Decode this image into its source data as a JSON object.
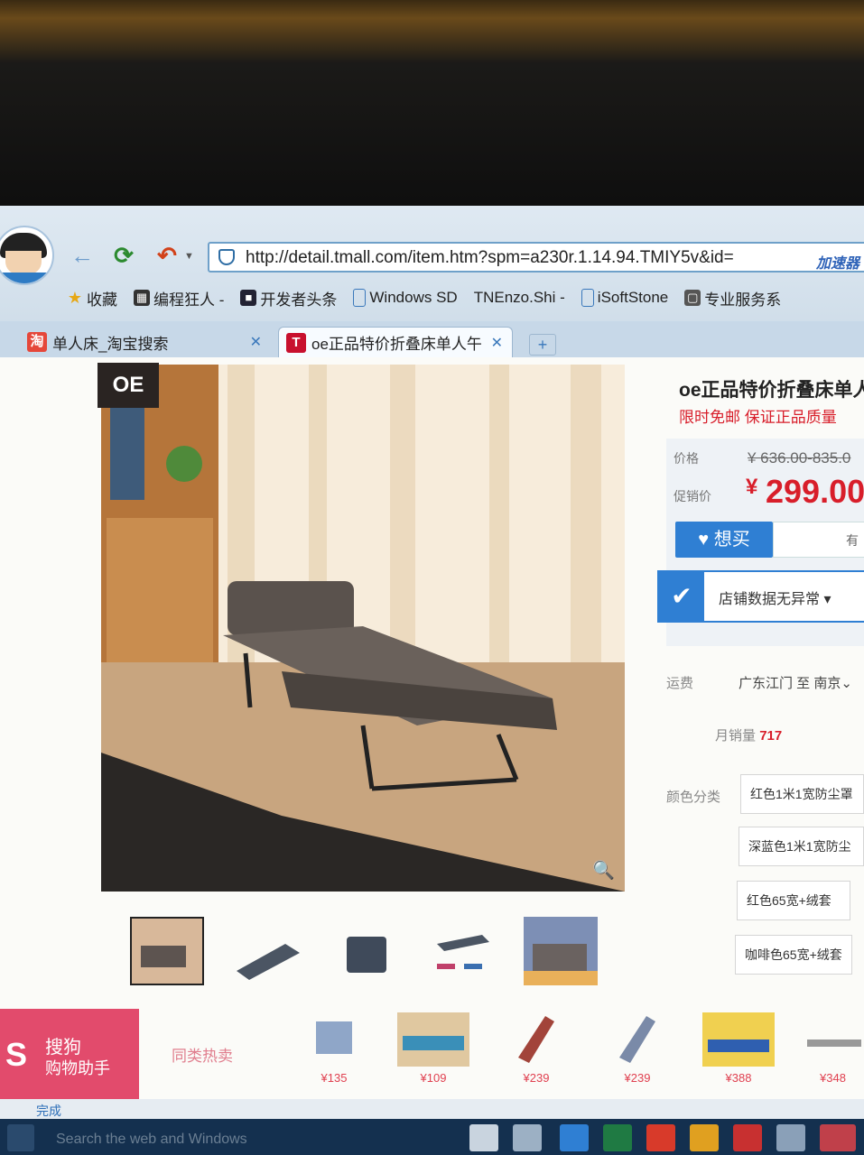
{
  "browser": {
    "url": "http://detail.tmall.com/item.htm?spm=a230r.1.14.94.TMIY5v&id=",
    "speed_label": "加速器",
    "bookmarks": [
      "收藏",
      "编程狂人 -",
      "开发者头条",
      "Windows SD",
      "TNEnzo.Shi -",
      "iSoftStone",
      "专业服务系"
    ],
    "tabs": [
      {
        "label": "单人床_淘宝搜索",
        "close": "✕"
      },
      {
        "label": "oe正品特价折叠床单人午",
        "close": "✕"
      }
    ],
    "new_tab": "+"
  },
  "product": {
    "logo": "OE",
    "title": "oe正品特价折叠床单人",
    "promo": "限时免邮 保证正品质量",
    "price_label": "价格",
    "old_price": "¥ 636.00-835.0",
    "promo_price_label": "促销价",
    "currency": "¥",
    "price": "299.00",
    "want_button": "想买",
    "want_side": "有",
    "store_status": "店铺数据无异常",
    "shipping_label": "运费",
    "shipping": "广东江门 至 南京",
    "monthly_sales_label": "月销量",
    "monthly_sales": "717",
    "color_label": "颜色分类",
    "options": [
      "红色1米1宽防尘罩",
      "深蓝色1米1宽防尘",
      "红色65宽+绒套",
      "咖啡色65宽+绒套"
    ]
  },
  "bottom": {
    "assistant_line1": "搜狗",
    "assistant_line2": "购物助手",
    "similar_label": "同类热卖",
    "similar_prices": [
      "¥135",
      "¥109",
      "¥239",
      "¥239",
      "¥388",
      "¥348"
    ]
  },
  "status": {
    "text": "完成"
  },
  "taskbar": {
    "search_placeholder": "Search the web and Windows"
  }
}
